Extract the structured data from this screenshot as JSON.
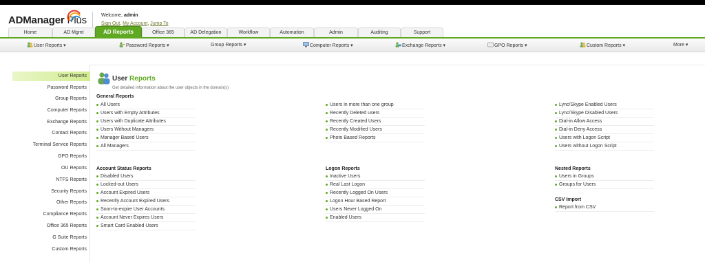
{
  "header": {
    "logo_text": "ADManager",
    "logo_plus": "Plus",
    "welcome_prefix": "Welcome,",
    "welcome_user": "admin",
    "links": [
      "Sign Out",
      "My Account",
      "Jump To"
    ]
  },
  "tabs": [
    {
      "label": "Home"
    },
    {
      "label": "AD Mgmt"
    },
    {
      "label": "AD Reports",
      "active": true
    },
    {
      "label": "Office 365"
    },
    {
      "label": "AD Delegation"
    },
    {
      "label": "Workflow"
    },
    {
      "label": "Automation"
    },
    {
      "label": "Admin"
    },
    {
      "label": "Auditing"
    },
    {
      "label": "Support"
    }
  ],
  "subnav": [
    {
      "label": "User Reports ▾",
      "icon": "users-icon"
    },
    {
      "label": "Password Reports ▾",
      "icon": "key-users-icon"
    },
    {
      "label": "Group Reports ▾",
      "icon": "group-icon"
    },
    {
      "label": "Computer Reports ▾",
      "icon": "computer-icon"
    },
    {
      "label": "Exchange Reports ▾",
      "icon": "exchange-icon"
    },
    {
      "label": "GPO Reports ▾",
      "icon": "gpo-icon"
    },
    {
      "label": "Custom Reports ▾",
      "icon": "custom-icon"
    },
    {
      "label": "More ▾",
      "icon": ""
    }
  ],
  "sidebar": [
    "User Reports",
    "Password Reports",
    "Group Reports",
    "Computer Reports",
    "Exchange Reports",
    "Contact Reports",
    "Terminal Service Reports",
    "GPO Reports",
    "OU Reports",
    "NTFS Reports",
    "Security Reports",
    "Other Reports",
    "Compliance Reports",
    "Office 365 Reports",
    "G Suite Reports",
    "Custom Reports"
  ],
  "page": {
    "title_prefix": "User",
    "title_rest": "Reports",
    "description": "Get detailed information about the user objects in the domain(s)"
  },
  "sections": {
    "general": {
      "title": "General Reports",
      "col1": [
        "All Users",
        "Users with Empty Attributes",
        "Users with Duplicate Attributes",
        "Users Without Managers",
        "Manager Based Users",
        "All Managers"
      ],
      "col2": [
        "Users in more than one group",
        "Recently Deleted users",
        "Recently Created Users",
        "Recently Modified Users",
        "Photo Based Reports"
      ],
      "col3": [
        "Lync/Skype Enabled Users",
        "Lync/Skype Disabled Users",
        "Dial-in Allow Access",
        "Dial-in Deny Access",
        "Users with Logon Script",
        "Users without Logon Script"
      ]
    },
    "account_status": {
      "title": "Account Status Reports",
      "items": [
        "Disabled Users",
        "Locked-out Users",
        "Account Expired Users",
        "Recently Account Expired Users",
        "Soon-to-expire User Accounts",
        "Account Never Expires Users",
        "Smart Card Enabled Users"
      ]
    },
    "logon": {
      "title": "Logon Reports",
      "items": [
        "Inactive Users",
        "Real Last Logon",
        "Recently Logged On Users",
        "Logon Hour Based Report",
        "Users Never Logged On",
        "Enabled Users"
      ]
    },
    "nested": {
      "title": "Nested Reports",
      "items": [
        "Users in Groups",
        "Groups for Users"
      ]
    },
    "csv": {
      "title": "CSV Import",
      "items": [
        "Report from CSV"
      ]
    }
  }
}
